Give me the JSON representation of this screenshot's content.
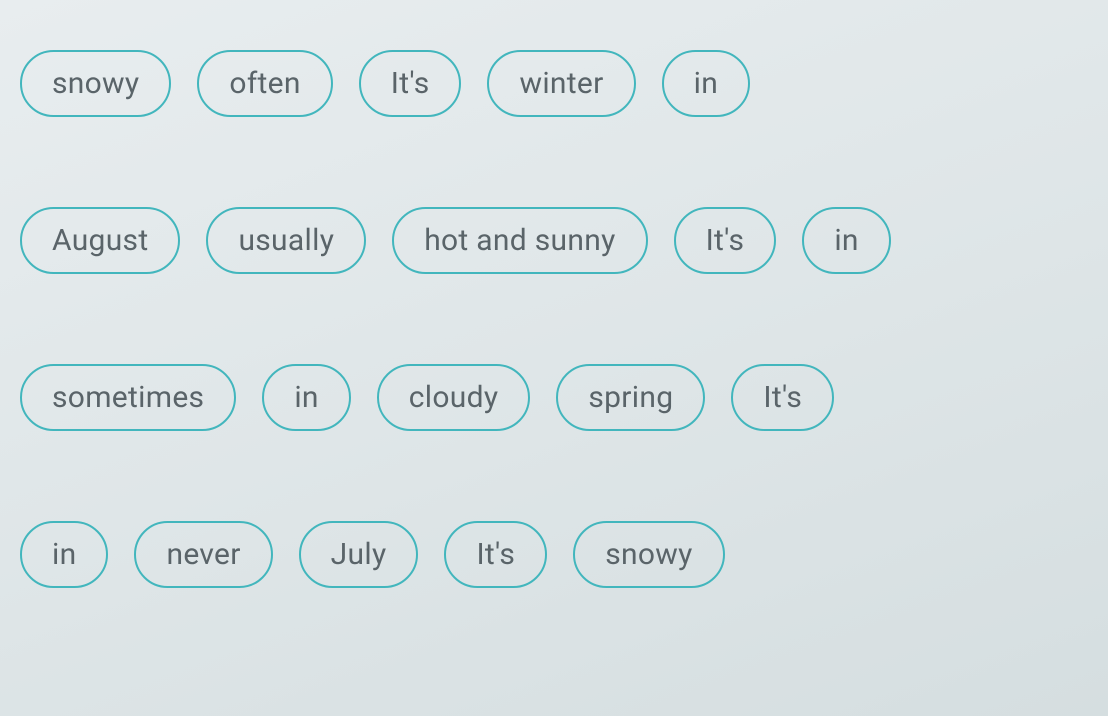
{
  "rows": [
    {
      "words": [
        "snowy",
        "often",
        "It's",
        "winter",
        "in"
      ]
    },
    {
      "words": [
        "August",
        "usually",
        "hot and sunny",
        "It's",
        "in"
      ]
    },
    {
      "words": [
        "sometimes",
        "in",
        "cloudy",
        "spring",
        "It's"
      ]
    },
    {
      "words": [
        "in",
        "never",
        "July",
        "It's",
        "snowy"
      ]
    }
  ]
}
